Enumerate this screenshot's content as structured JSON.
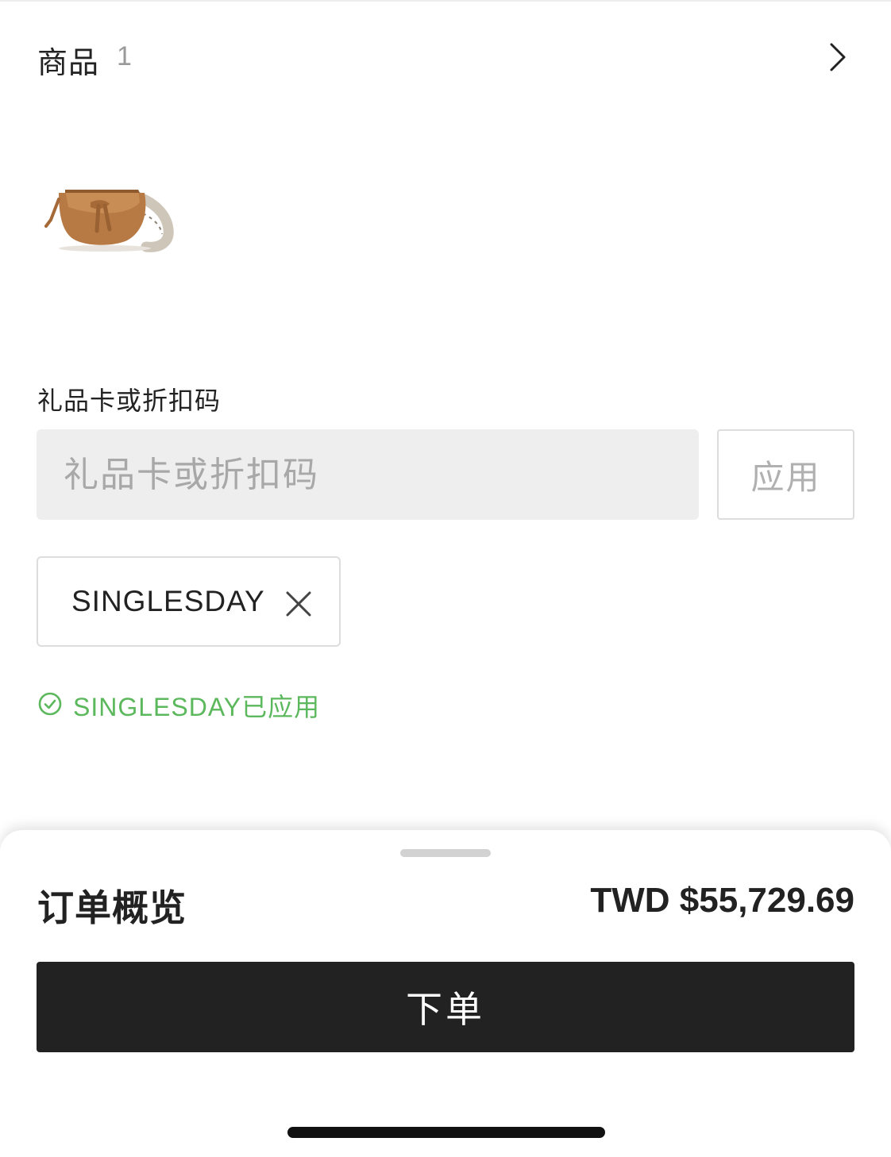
{
  "products": {
    "title": "商品",
    "count": "1",
    "chevron_icon": "chevron-right-icon",
    "items": [
      {
        "image": "tan leather saddle bag with logo strap"
      }
    ]
  },
  "promo": {
    "label": "礼品卡或折扣码",
    "placeholder": "礼品卡或折扣码",
    "apply_label": "应用",
    "applied_code": "SINGLESDAY",
    "remove_icon": "close-icon",
    "success_icon": "check-circle-icon",
    "success_message": "SINGLESDAY已应用",
    "success_color": "#5cb85c"
  },
  "summary": {
    "title": "订单概览",
    "total": "TWD $55,729.69",
    "place_order_label": "下单"
  },
  "colors": {
    "primary_button": "#222222",
    "input_background": "#eeeeee",
    "border": "#dddddd"
  }
}
